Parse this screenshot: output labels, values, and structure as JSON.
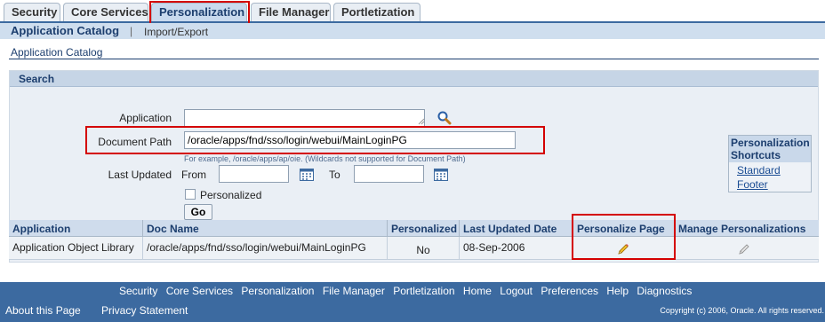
{
  "tabs": [
    {
      "label": "Security"
    },
    {
      "label": "Core Services"
    },
    {
      "label": "Personalization"
    },
    {
      "label": "File Manager"
    },
    {
      "label": "Portletization"
    }
  ],
  "subtabs": {
    "active": "Application Catalog",
    "separator": "|",
    "other": "Import/Export"
  },
  "page_title": "Application Catalog",
  "search": {
    "header": "Search",
    "application_label": "Application",
    "application_value": "",
    "document_path_label": "Document Path",
    "document_path_value": "/oracle/apps/fnd/sso/login/webui/MainLoginPG",
    "document_path_hint": "For example, /oracle/apps/ap/oie. (Wildcards not supported for Document Path)",
    "last_updated_label": "Last Updated",
    "from_label": "From",
    "to_label": "To",
    "from_value": "",
    "to_value": "",
    "personalized_label": "Personalized",
    "go_label": "Go"
  },
  "shortcuts": {
    "title": "Personalization Shortcuts",
    "links": [
      "Standard",
      "Footer"
    ]
  },
  "table": {
    "headers": [
      "Application",
      "Doc Name",
      "Personalized",
      "Last Updated Date",
      "Personalize Page",
      "Manage Personalizations"
    ],
    "rows": [
      {
        "application": "Application Object Library",
        "doc_name": "/oracle/apps/fnd/sso/login/webui/MainLoginPG",
        "personalized": "No",
        "last_updated": "08-Sep-2006",
        "personalize_icon": "pencil-icon",
        "manage_icon": "pencil-icon"
      }
    ]
  },
  "footer": {
    "links": [
      "Security",
      "Core Services",
      "Personalization",
      "File Manager",
      "Portletization",
      "Home",
      "Logout",
      "Preferences",
      "Help",
      "Diagnostics"
    ],
    "about": "About this Page",
    "privacy": "Privacy Statement",
    "copyright": "Copyright (c) 2006, Oracle. All rights reserved."
  },
  "colors": {
    "highlight": "#d40000",
    "brand": "#3c6aa0",
    "link": "#1a4c93"
  }
}
